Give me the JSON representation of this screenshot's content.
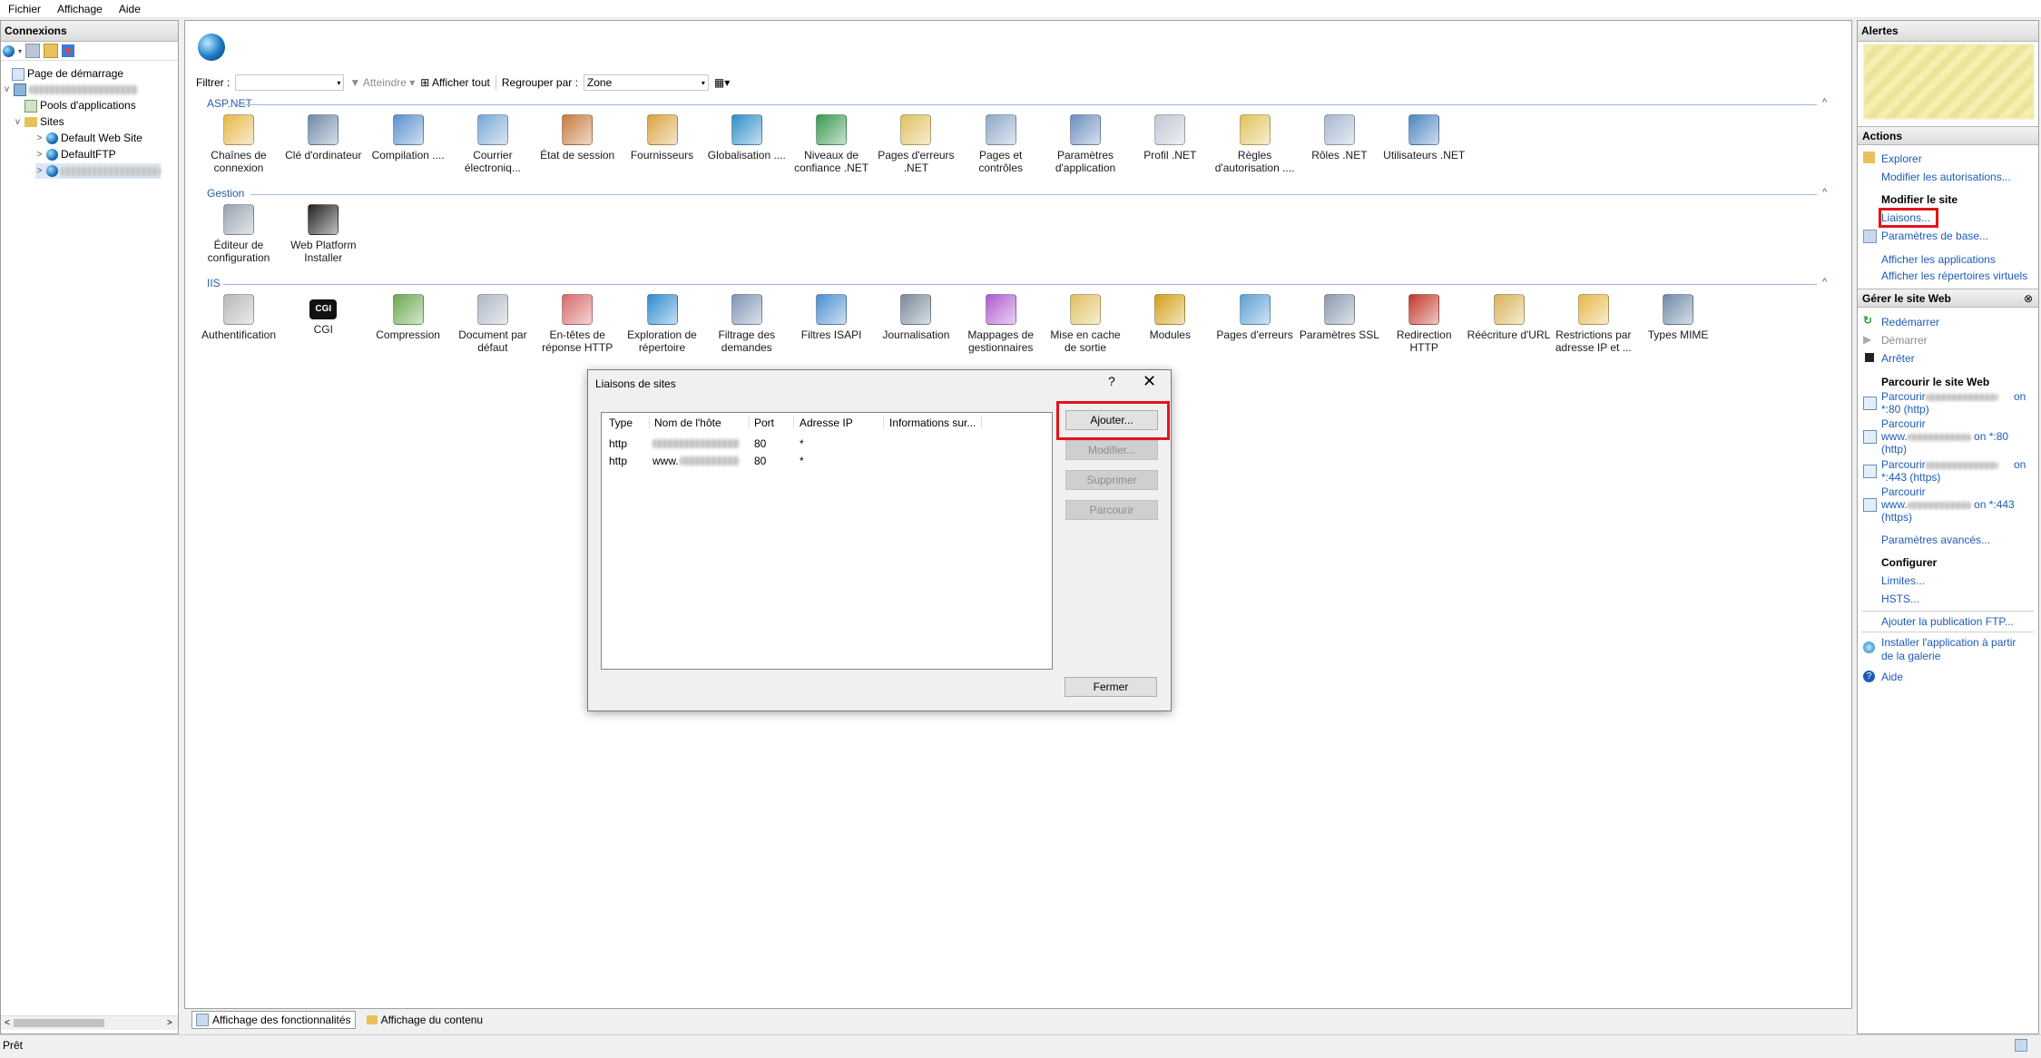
{
  "menu": [
    "Fichier",
    "Affichage",
    "Aide"
  ],
  "connections": {
    "title": "Connexions",
    "tree": {
      "start_page": "Page de démarrage",
      "app_pools": "Pools d'applications",
      "sites": "Sites",
      "default_web_site": "Default Web Site",
      "default_ftp": "DefaultFTP"
    }
  },
  "filterbar": {
    "filter_label": "Filtrer :",
    "go_label": "Atteindre",
    "show_all": "Afficher tout",
    "group_by_label": "Regrouper par :",
    "group_by_value": "Zone"
  },
  "sections": {
    "aspnet": "ASP.NET",
    "gestion": "Gestion",
    "iis": "IIS"
  },
  "features": {
    "aspnet": [
      {
        "label": "Chaînes de connexion",
        "icon": "connection-strings-icon"
      },
      {
        "label": "Clé d'ordinateur",
        "icon": "machine-key-icon"
      },
      {
        "label": "Compilation ....",
        "icon": "compilation-icon"
      },
      {
        "label": "Courrier électroniq...",
        "icon": "smtp-email-icon"
      },
      {
        "label": "État de session",
        "icon": "session-state-icon"
      },
      {
        "label": "Fournisseurs",
        "icon": "providers-icon"
      },
      {
        "label": "Globalisation ....",
        "icon": "globalization-icon"
      },
      {
        "label": "Niveaux de confiance .NET",
        "icon": "trust-levels-icon"
      },
      {
        "label": "Pages d'erreurs .NET",
        "icon": "error-pages-net-icon"
      },
      {
        "label": "Pages et contrôles",
        "icon": "pages-controls-icon"
      },
      {
        "label": "Paramètres d'application",
        "icon": "app-settings-icon"
      },
      {
        "label": "Profil .NET",
        "icon": "net-profile-icon"
      },
      {
        "label": "Règles d'autorisation ....",
        "icon": "authorization-rules-icon"
      },
      {
        "label": "Rôles .NET",
        "icon": "net-roles-icon"
      },
      {
        "label": "Utilisateurs .NET",
        "icon": "net-users-icon"
      }
    ],
    "gestion": [
      {
        "label": "Éditeur de configuration",
        "icon": "config-editor-icon"
      },
      {
        "label": "Web Platform Installer",
        "icon": "web-platform-installer-icon"
      }
    ],
    "iis": [
      {
        "label": "Authentification",
        "icon": "authentication-icon"
      },
      {
        "label": "CGI",
        "icon": "cgi-icon"
      },
      {
        "label": "Compression",
        "icon": "compression-icon"
      },
      {
        "label": "Document par défaut",
        "icon": "default-document-icon"
      },
      {
        "label": "En-têtes de réponse HTTP",
        "icon": "http-headers-icon"
      },
      {
        "label": "Exploration de répertoire",
        "icon": "directory-browsing-icon"
      },
      {
        "label": "Filtrage des demandes",
        "icon": "request-filtering-icon"
      },
      {
        "label": "Filtres ISAPI",
        "icon": "isapi-filters-icon"
      },
      {
        "label": "Journalisation",
        "icon": "logging-icon"
      },
      {
        "label": "Mappages de gestionnaires",
        "icon": "handler-mappings-icon"
      },
      {
        "label": "Mise en cache de sortie",
        "icon": "output-caching-icon"
      },
      {
        "label": "Modules",
        "icon": "modules-icon"
      },
      {
        "label": "Pages d'erreurs",
        "icon": "error-pages-icon"
      },
      {
        "label": "Paramètres SSL",
        "icon": "ssl-settings-icon"
      },
      {
        "label": "Redirection HTTP",
        "icon": "http-redirect-icon"
      },
      {
        "label": "Réécriture d'URL",
        "icon": "url-rewrite-icon"
      },
      {
        "label": "Restrictions par adresse IP et ...",
        "icon": "ip-restrictions-icon"
      },
      {
        "label": "Types MIME",
        "icon": "mime-types-icon"
      }
    ]
  },
  "bottom_tabs": {
    "features_view": "Affichage des fonctionnalités",
    "content_view": "Affichage du contenu"
  },
  "right": {
    "alerts_title": "Alertes",
    "actions_title": "Actions",
    "explore": "Explorer",
    "edit_permissions": "Modifier les autorisations...",
    "edit_site_header": "Modifier le site",
    "bindings": "Liaisons...",
    "basic_settings": "Paramètres de base...",
    "view_applications": "Afficher les applications",
    "view_virtual_dirs": "Afficher les répertoires virtuels",
    "manage_site_title": "Gérer le site Web",
    "restart": "Redémarrer",
    "start": "Démarrer",
    "stop": "Arrêter",
    "browse_header": "Parcourir le site Web",
    "browse1_a": "Parcourir",
    "browse1_b": "on",
    "browse1_c": "*:80 (http)",
    "browse2_a": "Parcourir",
    "browse2_b": "www.",
    "browse2_c": "on *:80",
    "browse2_d": "(http)",
    "browse3_a": "Parcourir",
    "browse3_b": "on",
    "browse3_c": "*:443 (https)",
    "browse4_a": "Parcourir",
    "browse4_b": "www.",
    "browse4_c": "on *:443",
    "browse4_d": "(https)",
    "advanced_settings": "Paramètres avancés...",
    "configure_header": "Configurer",
    "limits": "Limites...",
    "hsts": "HSTS...",
    "add_ftp": "Ajouter la publication FTP...",
    "install_gallery_1": "Installer l'application à partir",
    "install_gallery_2": "de la galerie",
    "help": "Aide"
  },
  "status": "Prêt",
  "dialog": {
    "title": "Liaisons de sites",
    "help_glyph": "?",
    "close_glyph": "✕",
    "columns": [
      "Type",
      "Nom de l'hôte",
      "Port",
      "Adresse IP",
      "Informations sur..."
    ],
    "rows": [
      {
        "type": "http",
        "host": "",
        "port": "80",
        "ip": "*"
      },
      {
        "type": "http",
        "host": "www.",
        "port": "80",
        "ip": "*"
      }
    ],
    "buttons": {
      "add": "Ajouter...",
      "edit": "Modifier...",
      "remove": "Supprimer",
      "browse": "Parcourir",
      "close": "Fermer"
    }
  },
  "colors": {
    "highlight_red": "#e3141b",
    "link_blue": "#1e5bb8",
    "section_blue": "#2a5ea8"
  }
}
